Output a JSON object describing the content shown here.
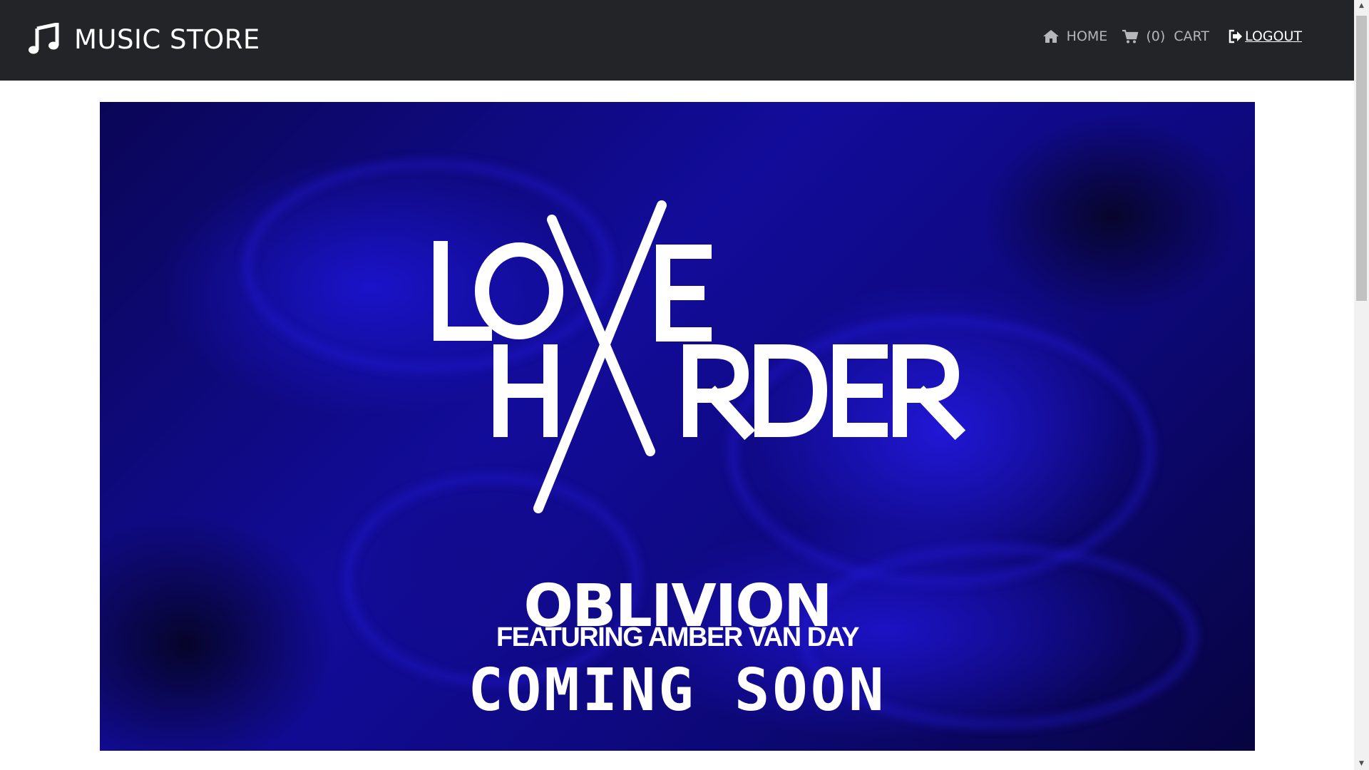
{
  "brand": {
    "name": "MUSIC STORE",
    "icon": "music-note-icon"
  },
  "nav": {
    "home_label": "HOME",
    "cart_count": "(0)",
    "cart_label": "CART",
    "logout_label": "LOGOUT"
  },
  "banner": {
    "logo_line1": "LOVE",
    "logo_line2": "HARDER",
    "title": "OBLIVION",
    "subtitle": "FEATURING AMBER VAN DAY",
    "tagline": "COMING SOON"
  },
  "colors": {
    "navbar_bg": "#222427",
    "nav_text": "#b4b6b8",
    "banner_blue": "#1a13c9"
  }
}
